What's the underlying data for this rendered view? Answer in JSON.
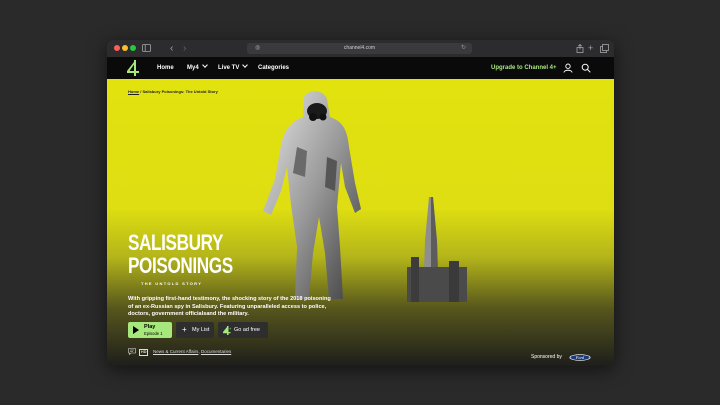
{
  "browser": {
    "url": "channel4.com",
    "traffic_colors": [
      "#ff5f57",
      "#febc2e",
      "#28c840"
    ]
  },
  "nav": {
    "items": [
      {
        "label": "Home"
      },
      {
        "label": "My4"
      },
      {
        "label": "Live TV"
      },
      {
        "label": "Categories"
      }
    ],
    "upgrade": "Upgrade to Channel 4+",
    "accent": "#a7e87c"
  },
  "hero": {
    "breadcrumb": {
      "home": "Home",
      "separator": " / ",
      "current": "Salisbury Poisonings: The Untold Story"
    },
    "title_line1": "SALISBURY",
    "title_line2": "POISONINGS",
    "subtitle": "THE UNTOLD STORY",
    "description": "With gripping first-hand testimony, the shocking story of the 2018 poisoning of an ex-Russian spy in Salisbury. Featuring unparalleled access to police, doctors, government officialsand the military.",
    "play": {
      "label": "Play",
      "episode": "Episode 1"
    },
    "my_list": "My List",
    "ad_free": "Go ad free",
    "badge": "HD",
    "genres": [
      "News & Current Affairs",
      "Documentaries"
    ],
    "genre_separator": ", ",
    "sponsor": "Sponsored by",
    "sponsor_brand": "Ford"
  }
}
